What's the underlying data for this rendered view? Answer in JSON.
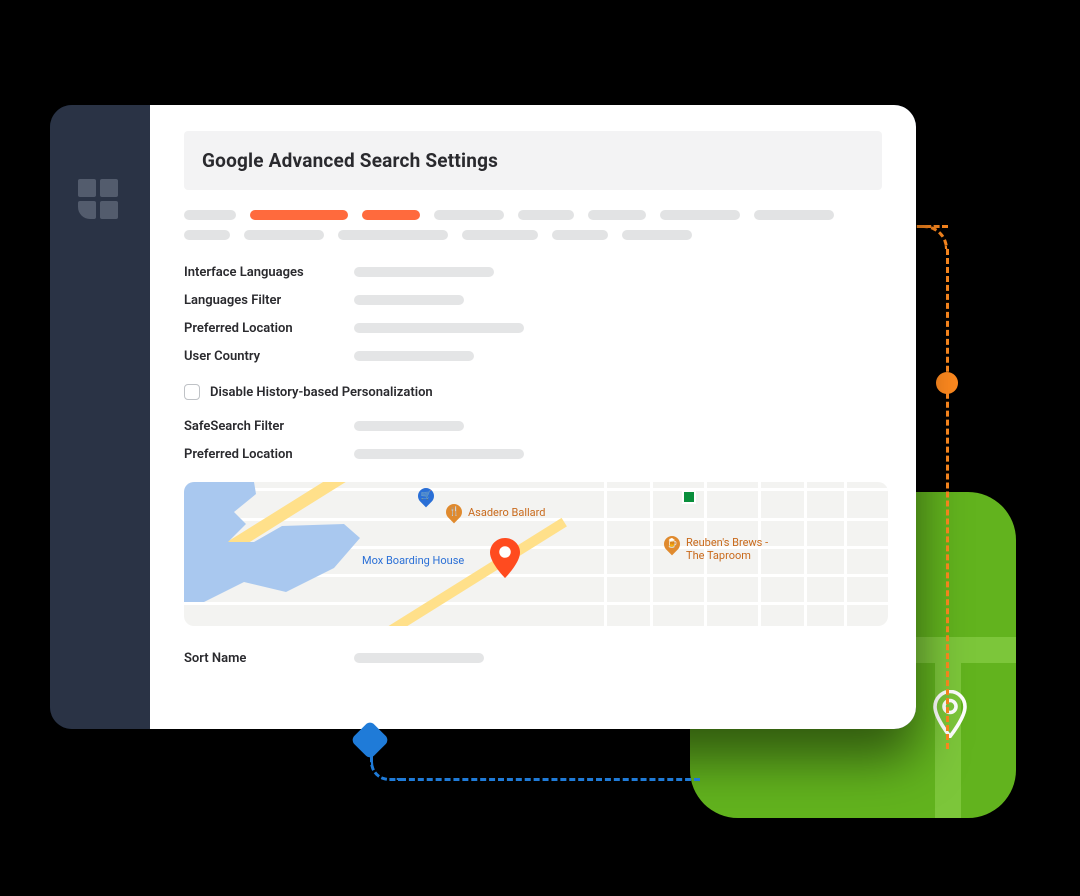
{
  "header": {
    "title": "Google Advanced Search Settings"
  },
  "fields": {
    "interface_languages": "Interface Languages",
    "languages_filter": "Languages Filter",
    "preferred_location": "Preferred Location",
    "user_country": "User Country",
    "safesearch_filter": "SafeSearch Filter",
    "preferred_location2": "Preferred Location",
    "sort_name": "Sort Name"
  },
  "checkbox": {
    "label": "Disable History-based Personalization"
  },
  "map_pois": {
    "mox": "Mox Boarding House",
    "asadero": "Asadero Ballard",
    "reubens_line1": "Reuben's Brews -",
    "reubens_line2": "The Taproom"
  },
  "icons": {
    "cart": "🛒",
    "fork": "🍴",
    "beer": "🍺"
  }
}
